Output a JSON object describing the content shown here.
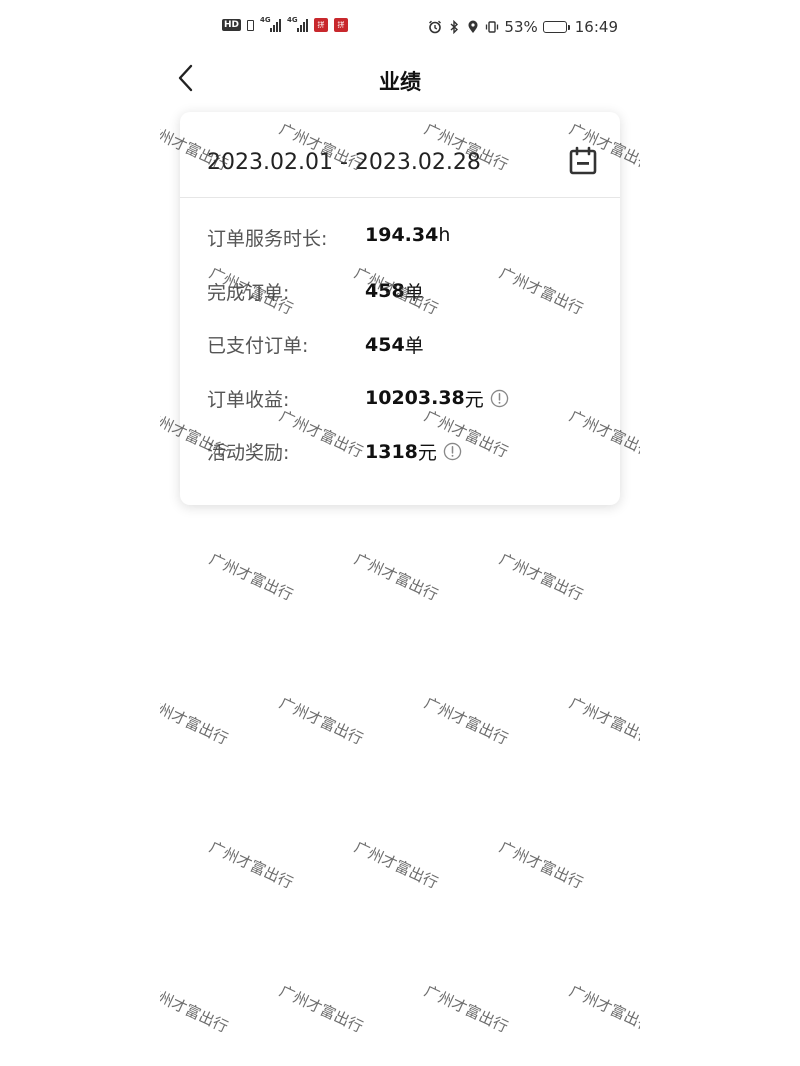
{
  "status_bar": {
    "hd": "HD",
    "network_1": "4G",
    "network_2": "4G",
    "app_badge_1": "拼",
    "app_badge_2": "拼",
    "battery_percent": "53%",
    "battery_level": 0.53,
    "time": "16:49",
    "icons": [
      "alarm-icon",
      "bluetooth-icon",
      "location-icon",
      "vibrate-icon"
    ]
  },
  "nav": {
    "title": "业绩",
    "back_icon": "chevron-left-icon"
  },
  "card": {
    "date_range": "2023.02.01 - 2023.02.28",
    "calendar_icon": "calendar-icon",
    "stats": [
      {
        "label": "订单服务时长:",
        "value": "194.34",
        "unit": "h",
        "info": false
      },
      {
        "label": "完成订单:",
        "value": "458",
        "unit": "单",
        "info": false
      },
      {
        "label": "已支付订单:",
        "value": "454",
        "unit": "单",
        "info": false
      },
      {
        "label": "订单收益:",
        "value": "10203.38",
        "unit": "元",
        "info": true
      },
      {
        "label": "活动奖励:",
        "value": "1318",
        "unit": "元",
        "info": true
      }
    ]
  },
  "watermark_text": "广州才富出行",
  "colors": {
    "background": "#ffffff",
    "text_primary": "#111111",
    "text_secondary": "#555555",
    "divider": "#e6e6e6",
    "app_badge": "#c8282d"
  }
}
